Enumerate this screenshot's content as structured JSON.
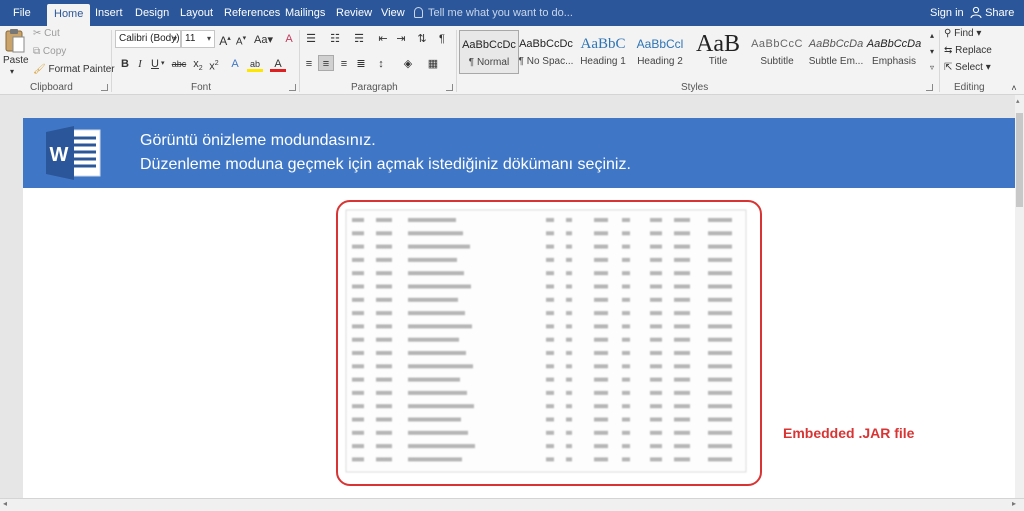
{
  "tabs": [
    {
      "label": "File"
    },
    {
      "label": "Home"
    },
    {
      "label": "Insert"
    },
    {
      "label": "Design"
    },
    {
      "label": "Layout"
    },
    {
      "label": "References"
    },
    {
      "label": "Mailings"
    },
    {
      "label": "Review"
    },
    {
      "label": "View"
    }
  ],
  "tell_me": "Tell me what you want to do...",
  "sign_in": "Sign in",
  "share": "Share",
  "clipboard": {
    "paste": "Paste",
    "cut": "Cut",
    "copy": "Copy",
    "format_painter": "Format Painter",
    "label": "Clipboard"
  },
  "font": {
    "name": "Calibri (Body)",
    "size": "11",
    "label": "Font",
    "case": "Aa"
  },
  "paragraph": {
    "label": "Paragraph"
  },
  "styles": {
    "label": "Styles",
    "items": [
      {
        "sample": "AaBbCcDc",
        "name": "¶ Normal"
      },
      {
        "sample": "AaBbCcDc",
        "name": "¶ No Spac..."
      },
      {
        "sample": "AaBbC",
        "name": "Heading 1"
      },
      {
        "sample": "AaBbCcl",
        "name": "Heading 2"
      },
      {
        "sample": "AaB",
        "name": "Title"
      },
      {
        "sample": "AaBbCcC",
        "name": "Subtitle"
      },
      {
        "sample": "AaBbCcDa",
        "name": "Subtle Em..."
      },
      {
        "sample": "AaBbCcDa",
        "name": "Emphasis"
      }
    ]
  },
  "editing": {
    "find": "Find",
    "replace": "Replace",
    "select": "Select",
    "label": "Editing"
  },
  "banner": {
    "line1": "Görüntü önizleme modundasınız.",
    "line2": "Düzenleme moduna geçmek için açmak istediğiniz dökümanı seçiniz.",
    "logo_letter": "W"
  },
  "annotation": "Embedded .JAR file",
  "colors": {
    "accent": "#2b579a",
    "banner": "#3f77c6",
    "highlight": "#d93434"
  }
}
